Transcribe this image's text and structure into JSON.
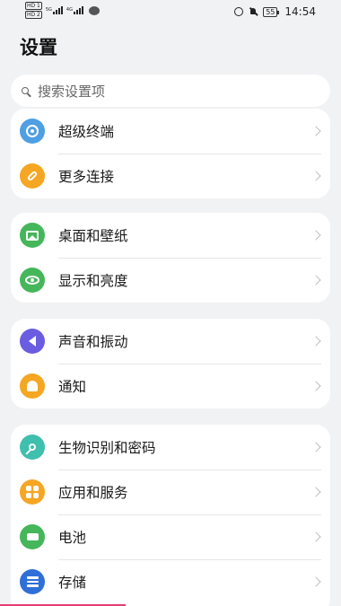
{
  "status_bar": {
    "sim1": "HD 1",
    "sim2": "HD 2",
    "net1": "5G",
    "net2": "4G",
    "battery": "55",
    "time": "14:54"
  },
  "page": {
    "title": "设置"
  },
  "search": {
    "placeholder": "搜索设置项"
  },
  "groups": [
    {
      "items": [
        {
          "label": "超级终端",
          "icon": "super-device-icon",
          "color": "#4f9fe3"
        },
        {
          "label": "更多连接",
          "icon": "link-icon",
          "color": "#f5a623"
        }
      ]
    },
    {
      "items": [
        {
          "label": "桌面和壁纸",
          "icon": "wallpaper-icon",
          "color": "#46b65a"
        },
        {
          "label": "显示和亮度",
          "icon": "eye-icon",
          "color": "#46b65a"
        }
      ]
    },
    {
      "items": [
        {
          "label": "声音和振动",
          "icon": "speaker-icon",
          "color": "#6a5de1"
        },
        {
          "label": "通知",
          "icon": "bell-icon",
          "color": "#f5a623"
        }
      ]
    },
    {
      "items": [
        {
          "label": "生物识别和密码",
          "icon": "key-icon",
          "color": "#3fbfad"
        },
        {
          "label": "应用和服务",
          "icon": "apps-icon",
          "color": "#f5a623"
        },
        {
          "label": "电池",
          "icon": "battery-icon",
          "color": "#46b65a"
        },
        {
          "label": "存储",
          "icon": "storage-icon",
          "color": "#2f6fd8"
        }
      ]
    }
  ]
}
